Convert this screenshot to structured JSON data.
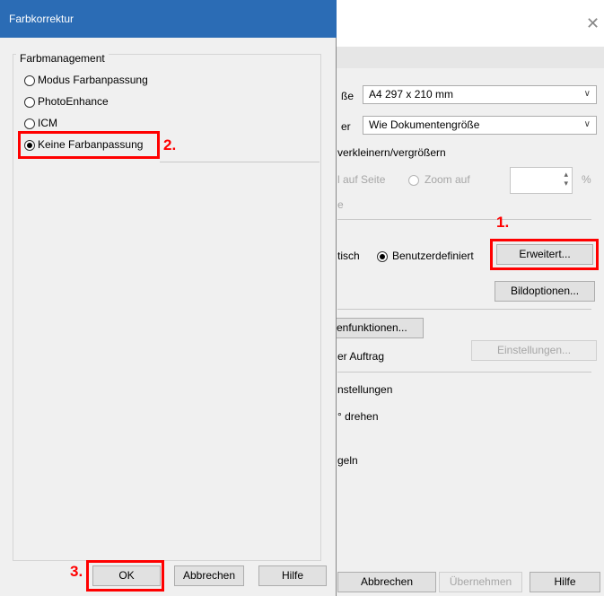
{
  "background_dialog": {
    "rows": {
      "paper_size_label": "ße",
      "paper_size_value": "A4 297 x 210 mm",
      "output_label": "er",
      "output_value": "Wie Dokumentengröße",
      "scale_label": "verkleinern/vergrößern",
      "fit_page_label": "l auf Seite",
      "zoom_label": "Zoom auf",
      "percent_sign": "%",
      "e_label": "e",
      "auto_label": "tisch",
      "custom_label": "Benutzerdefiniert",
      "functions_label": "enfunktionen...",
      "job_label": "er Auftrag",
      "settings_label": "nstellungen",
      "rotate_label": "° drehen",
      "mirror_label": "geln"
    },
    "buttons": {
      "advanced": "Erweitert...",
      "image_options": "Bildoptionen...",
      "settings": "Einstellungen...",
      "cancel": "Abbrechen",
      "apply": "Übernehmen",
      "help": "Hilfe"
    }
  },
  "dialog": {
    "title": "Farbkorrektur",
    "group_label": "Farbmanagement",
    "options": [
      {
        "label": "Modus Farbanpassung",
        "selected": false
      },
      {
        "label": "PhotoEnhance",
        "selected": false
      },
      {
        "label": "ICM",
        "selected": false
      },
      {
        "label": "Keine Farbanpassung",
        "selected": true
      }
    ],
    "buttons": {
      "ok": "OK",
      "cancel": "Abbrechen",
      "help": "Hilfe"
    }
  },
  "annotations": {
    "step1": "1.",
    "step2": "2.",
    "step3": "3."
  },
  "colors": {
    "title_bar": "#2b6cb5",
    "highlight": "#ff0000"
  }
}
